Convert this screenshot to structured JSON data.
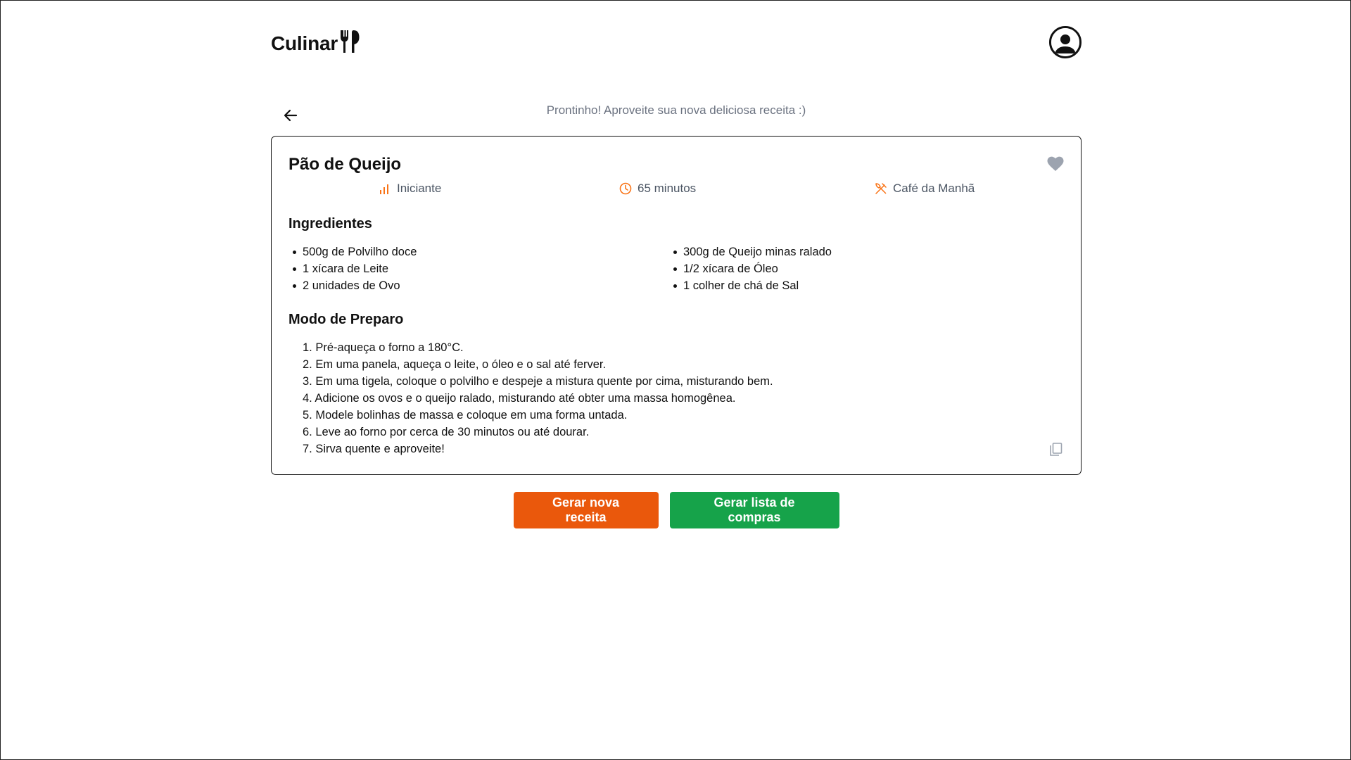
{
  "brand": {
    "name": "Culinar",
    "logo_icon": "fork-spoon-icon"
  },
  "header": {
    "profile_icon": "user-circle-icon"
  },
  "subtitle": "Prontinho! Aproveite sua nova deliciosa receita :)",
  "recipe": {
    "title": "Pão de Queijo",
    "difficulty": "Iniciante",
    "time": "65 minutos",
    "category": "Café da Manhã",
    "ingredients_title": "Ingredientes",
    "ingredients_left": [
      "500g de Polvilho doce",
      "1 xícara de Leite",
      "2 unidades de Ovo"
    ],
    "ingredients_right": [
      "300g de Queijo minas ralado",
      "1/2 xícara de Óleo",
      "1 colher de chá de Sal"
    ],
    "preparation_title": "Modo de Preparo",
    "steps": [
      "1. Pré-aqueça o forno a 180°C.",
      "2. Em uma panela, aqueça o leite, o óleo e o sal até ferver.",
      "3. Em uma tigela, coloque o polvilho e despeje a mistura quente por cima, misturando bem.",
      "4. Adicione os ovos e o queijo ralado, misturando até obter uma massa homogênea.",
      "5. Modele bolinhas de massa e coloque em uma forma untada.",
      "6. Leve ao forno por cerca de 30 minutos ou até dourar.",
      "7. Sirva quente e aproveite!"
    ]
  },
  "actions": {
    "new_recipe": "Gerar nova receita",
    "shopping_list": "Gerar lista de compras"
  },
  "colors": {
    "accent_orange": "#ea580c",
    "accent_green": "#16a34a",
    "meta_icon": "#f97316",
    "muted_icon": "#9ca3af"
  }
}
